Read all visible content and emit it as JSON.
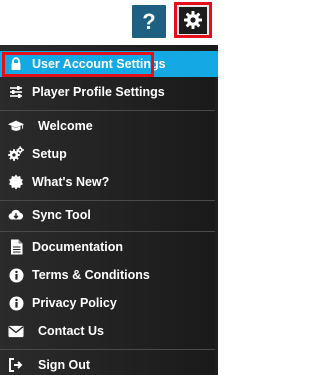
{
  "header": {
    "help_label": "?"
  },
  "menu": {
    "items": [
      {
        "label": "User Account Settings",
        "icon": "lock-icon"
      },
      {
        "label": "Player Profile Settings",
        "icon": "sliders-icon"
      },
      {
        "label": "Welcome",
        "icon": "graduation-cap-icon"
      },
      {
        "label": "Setup",
        "icon": "cogs-icon"
      },
      {
        "label": "What's New?",
        "icon": "certificate-icon"
      },
      {
        "label": "Sync Tool",
        "icon": "cloud-download-icon"
      },
      {
        "label": "Documentation",
        "icon": "document-icon"
      },
      {
        "label": "Terms & Conditions",
        "icon": "info-circle-icon"
      },
      {
        "label": "Privacy Policy",
        "icon": "info-circle-icon"
      },
      {
        "label": "Contact Us",
        "icon": "envelope-icon"
      },
      {
        "label": "Sign Out",
        "icon": "sign-out-icon"
      }
    ]
  },
  "colors": {
    "accent": "#14a9e4",
    "highlight_outline": "#e3101b",
    "help_button": "#1f5f82"
  }
}
